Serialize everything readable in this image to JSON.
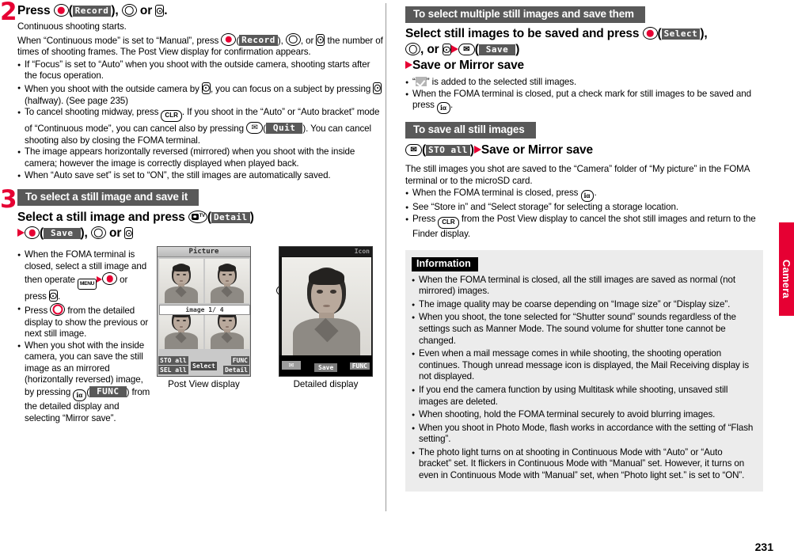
{
  "page": {
    "number": "231",
    "edge_tab_label": "Camera",
    "accent_red": "#e60033",
    "bar_gray": "#595959"
  },
  "left": {
    "step2": {
      "number": "2",
      "heading_pre": "Press",
      "heading_mid": "Record",
      "heading_post": "or",
      "body1": "Continuous shooting starts.",
      "body2_a": "When “Continuous mode” is set to “Manual”, press",
      "body2_b": "Record",
      "body2_c": ", or",
      "body2_d": "the number of times of shooting frames. The Post View display for confirmation appears.",
      "bullets": [
        "If “Focus” is set to “Auto” when you shoot with the outside camera, shooting starts after the focus operation.",
        "When you shoot with the outside camera by  , you can focus on a subject by pressing (halfway). (See page 235)",
        "To cancel shooting midway, press CLR. If you shoot in the “Auto” or “Auto bracket” mode of “Continuous mode”, you can cancel also by pressing ( Quit ). You can cancel shooting also by closing the FOMA terminal.",
        "The image appears horizontally reversed (mirrored) when you shoot with the inside camera; however the image is correctly displayed when played back.",
        "When “Auto save set” is set to “ON”, the still images are automatically saved."
      ],
      "bullet2_a": "When you shoot with the outside camera by",
      "bullet2_b": ", you can focus on a subject by pressing",
      "bullet2_c": "(halfway). (See page 235)",
      "bullet3_a": "To cancel shooting midway, press",
      "bullet3_b": ". If you shoot in the “Auto” or “Auto bracket” mode of “Continuous mode”, you can cancel also by pressing",
      "bullet3_quit": "Quit",
      "bullet3_c": "). You can cancel shooting also by closing the FOMA terminal.",
      "bullet4": "The image appears horizontally reversed (mirrored) when you shoot with the inside camera; however the image is correctly displayed when played back.",
      "bullet5": "When “Auto save set” is set to “ON”, the still images are automatically saved.",
      "key_clr": "CLR"
    },
    "step3": {
      "number": "3",
      "section_title": "To select a still image and save it",
      "heading_a": "Select a still image and press",
      "heading_detail": "Detail",
      "heading_save": "Save",
      "heading_or": "or",
      "bullets": {
        "b1_a": "When the FOMA terminal is closed, select a still image and then operate",
        "b1_b": "or press",
        "b1_menu": "MENU",
        "b2_a": "Press",
        "b2_b": "from the detailed display to show the previous or next still image.",
        "b3_a": "When you shot with the inside camera, you can save the still image as an mirrored (horizontally reversed) image, by pressing",
        "b3_func": "FUNC",
        "b3_b": ") from the detailed display and selecting “Mirror save”."
      }
    },
    "figures": {
      "postview": {
        "caption": "Post View display",
        "title": "Picture",
        "image_counter": "image  1/ 4",
        "softkeys": {
          "sto_all": "STO all",
          "sel_all": "SEL all",
          "select": "Select",
          "func": "FUNC",
          "detail": "Detail"
        }
      },
      "detailed": {
        "caption": "Detailed display",
        "icon_label": "Icon",
        "softkeys": {
          "save": "Save",
          "func": "FUNC"
        }
      }
    }
  },
  "right": {
    "multi": {
      "section_title": "To select multiple still images and save them",
      "heading_a": "Select still images to be saved and press",
      "heading_select": "Select",
      "heading_b": ", or",
      "heading_save": "Save",
      "heading_c": "Save or Mirror save",
      "bullet1_a": "“",
      "bullet1_b": "” is added to the selected still images.",
      "bullet2": "When the FOMA terminal is closed, put a check mark for still images to be saved and press"
    },
    "saveall": {
      "section_title": "To save all still images",
      "heading_sto": "STO all",
      "heading_b": "Save or Mirror save",
      "body": "The still images you shot are saved to the “Camera” folder of “My picture” in the FOMA terminal or to the microSD card.",
      "bullet1": "When the FOMA terminal is closed, press",
      "bullet2": "See “Store in” and “Select storage” for selecting a storage location.",
      "bullet3_a": "Press",
      "bullet3_b": "from the Post View display to cancel the shot still images and return to the Finder display.",
      "key_clr": "CLR"
    },
    "information": {
      "title": "Information",
      "items": [
        "When the FOMA terminal is closed, all the still images are saved as normal (not mirrored) images.",
        "The image quality may be coarse depending on “Image size” or “Display size”.",
        "When you shoot, the tone selected for “Shutter sound” sounds regardless of the settings such as Manner Mode. The sound volume for shutter tone cannot be changed.",
        "Even when a mail message comes in while shooting, the shooting operation continues. Though unread message icon is displayed, the Mail Receiving display is not displayed.",
        "If you end the camera function by using Multitask while shooting, unsaved still images are deleted.",
        "When shooting, hold the FOMA terminal securely to avoid blurring images.",
        "When you shoot in Photo Mode, flash works in accordance with the setting of “Flash setting”.",
        "The photo light turns on at shooting in Continuous Mode with “Auto” or “Auto bracket” set. It flickers in Continuous Mode with “Manual” set. However, it turns on even in Continuous Mode with “Manual” set, when “Photo light set.” is set to “ON”."
      ]
    }
  }
}
